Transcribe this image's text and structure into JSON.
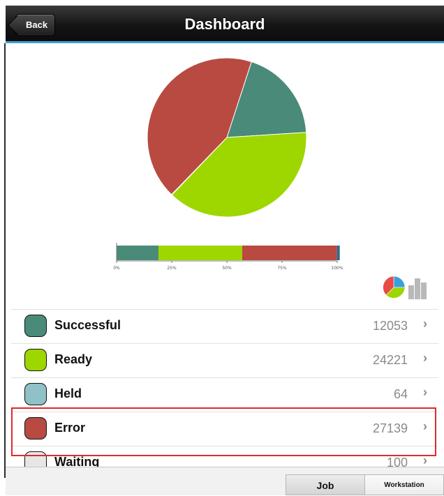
{
  "header": {
    "title": "Dashboard",
    "back_label": "Back"
  },
  "chart_data": [
    {
      "type": "pie",
      "categories": [
        "Successful",
        "Ready",
        "Held",
        "Error"
      ],
      "values": [
        12053,
        24221,
        64,
        27139
      ],
      "colors": [
        "#4a8a78",
        "#9ed600",
        "#2d6a8c",
        "#b84a42"
      ]
    },
    {
      "type": "bar",
      "orientation": "horizontal-stacked",
      "categories": [
        "Successful",
        "Ready",
        "Error",
        "Held"
      ],
      "values": [
        19,
        38,
        43,
        0.1
      ],
      "xticks": [
        "0%",
        "25%",
        "50%",
        "75%",
        "100%"
      ],
      "colors": [
        "#4a8a78",
        "#9ed600",
        "#b84a42",
        "#2d6a8c"
      ]
    }
  ],
  "statuses": [
    {
      "label": "Successful",
      "count": "12053",
      "color": "#4a8a78"
    },
    {
      "label": "Ready",
      "count": "24221",
      "color": "#9ed600"
    },
    {
      "label": "Held",
      "count": "64",
      "color": "#8fc1c7"
    },
    {
      "label": "Error",
      "count": "27139",
      "color": "#b84a42"
    },
    {
      "label": "Waiting",
      "count": "100",
      "color": "#e6e6e6"
    }
  ],
  "icons": {
    "chevron": "chevron-right-icon",
    "pie_toggle": "pie-chart-icon",
    "bar_toggle": "bar-chart-icon"
  },
  "tabs": {
    "job": "Job",
    "workstation": "Workstation"
  }
}
